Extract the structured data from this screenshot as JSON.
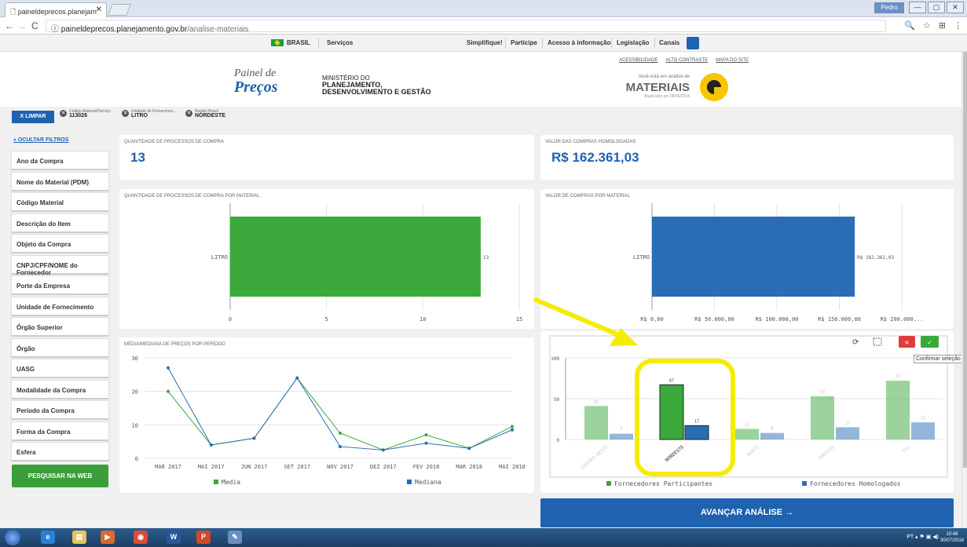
{
  "browser": {
    "tab_title": "paineldeprecos.planejam",
    "url_host": "paineldeprecos.planejamento.gov.br",
    "url_path": "/analise-materiais",
    "profile": "Pedro"
  },
  "gov": {
    "brasil": "BRASIL",
    "servicos": "Serviços",
    "links": [
      "Simplifique!",
      "Participe",
      "Acesso à informação",
      "Legislação",
      "Canais"
    ]
  },
  "header": {
    "logo_line1": "Painel de",
    "logo_line2": "Preços",
    "ministry_line1": "MINISTÉRIO DO",
    "ministry_line2": "PLANEJAMENTO,",
    "ministry_line3": "DESENVOLVIMENTO E GESTÃO",
    "toplinks": [
      "ACESSIBILIDADE",
      "ALTO CONTRASTE",
      "MAPA DO SITE"
    ],
    "voce": "Você está em análise de",
    "materiais": "MATERIAIS",
    "atualizado": "Atualizado em 08/06/2018"
  },
  "filters": {
    "limpar": "X LIMPAR",
    "chips": [
      {
        "label": "Código Material/Serviço",
        "value": "113026"
      },
      {
        "label": "Unidade de Fornecimen...",
        "value": "LITRO"
      },
      {
        "label": "Região Brasil",
        "value": "NORDESTE"
      }
    ]
  },
  "sidebar": {
    "hide": "OCULTAR FILTROS",
    "items": [
      "Ano da Compra",
      "Nome do Material (PDM)",
      "Código Material",
      "Descrição do Item",
      "Objeto da Compra",
      "CNPJ/CPF/NOME do Fornecedor",
      "Porte da Empresa",
      "Unidade de Fornecimento",
      "Órgão Superior",
      "Órgão",
      "UASG",
      "Modalidade da Compra",
      "Período da Compra",
      "Forma da Compra",
      "Esfera"
    ],
    "pesquisar": "PESQUISAR NA WEB"
  },
  "kpis": {
    "qtd_title": "QUANTIDADE DE PROCESSOS DE COMPRA",
    "qtd_value": "13",
    "valor_title": "VALOR DAS COMPRAS HOMOLOGADAS",
    "valor_value": "R$ 162.361,03"
  },
  "avancar": "AVANÇAR ANÁLISE  →",
  "tooltip": "Confirmar seleção",
  "taskbar": {
    "lang": "PT",
    "time": "10:48",
    "date": "30/07/2018"
  },
  "colors": {
    "accent": "#1f62b0",
    "green": "#3aa83a",
    "highlight": "#f5ec00"
  },
  "chart_data": [
    {
      "type": "bar",
      "orientation": "horizontal",
      "title": "QUANTIDADE DE PROCESSOS DE COMPRA POR MATERIAL",
      "categories": [
        "LITRO"
      ],
      "values": [
        13
      ],
      "value_labels": [
        "13"
      ],
      "xlim": [
        0,
        15
      ],
      "xticks": [
        "0",
        "5",
        "10",
        "15"
      ],
      "color": "#3aa83a"
    },
    {
      "type": "bar",
      "orientation": "horizontal",
      "title": "VALOR DE COMPRAS POR MATERIAL",
      "categories": [
        "LITRO"
      ],
      "values": [
        162361.03
      ],
      "value_labels": [
        "R$ 162.361,03"
      ],
      "xlim": [
        0,
        200000
      ],
      "xticks": [
        "R$ 0,00",
        "R$ 50.000,00",
        "R$ 100.000,00",
        "R$ 150.000,00",
        "R$ 200.000..."
      ],
      "color": "#2a6db5"
    },
    {
      "type": "line",
      "title": "MÉDIA/MEDIANA DE PREÇOS POR PERÍODO",
      "categories": [
        "MAR 2017",
        "MAI 2017",
        "JUN 2017",
        "SET 2017",
        "NOV 2017",
        "DEZ 2017",
        "FEV 2018",
        "MAR 2018",
        "MAI 2018"
      ],
      "ylim": [
        0,
        30
      ],
      "yticks": [
        "0",
        "10",
        "20",
        "30"
      ],
      "series": [
        {
          "name": "Media",
          "color": "#3aa83a",
          "values": [
            20,
            4,
            6,
            24,
            7.5,
            2.5,
            7,
            3,
            9.5
          ]
        },
        {
          "name": "Mediana",
          "color": "#2a6db5",
          "values": [
            27,
            4,
            6,
            24,
            3.5,
            2.5,
            4.5,
            3,
            8.5
          ]
        }
      ]
    },
    {
      "type": "bar",
      "title": "",
      "categories": [
        "CENTRO-OESTE",
        "NORDESTE",
        "NORTE",
        "SUDESTE",
        "SUL"
      ],
      "ylim": [
        0,
        100
      ],
      "yticks": [
        "0",
        "50",
        "100"
      ],
      "selected": "NORDESTE",
      "series": [
        {
          "name": "Fornecedores Participantes",
          "color": "#3aa83a",
          "values": [
            41,
            67,
            13,
            53,
            72
          ]
        },
        {
          "name": "Fornecedores Homologados",
          "color": "#2a6db5",
          "values": [
            7,
            17,
            8,
            15,
            21
          ]
        }
      ]
    }
  ]
}
